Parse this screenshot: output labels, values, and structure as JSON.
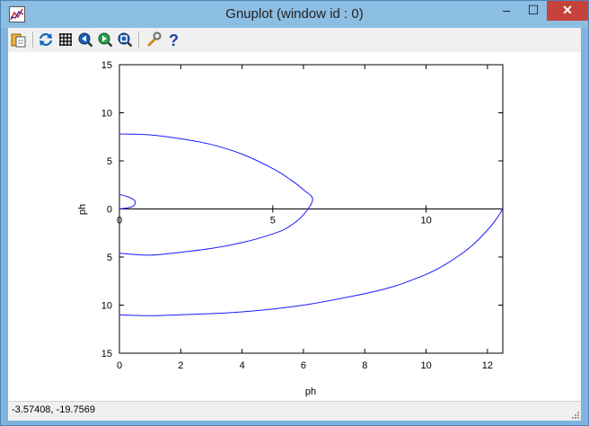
{
  "window": {
    "title": "Gnuplot (window id : 0)",
    "controls": {
      "minimize": "–",
      "maximize": "☐",
      "close": "✕"
    }
  },
  "toolbar": {
    "buttons": [
      "copy-to-clipboard-icon",
      "replot-icon",
      "grid-icon",
      "zoom-previous-icon",
      "zoom-next-icon",
      "unzoom-icon",
      "options-icon",
      "help-icon"
    ]
  },
  "statusbar": {
    "coordinates": "-3.57408, -19.7569"
  },
  "chart_data": {
    "type": "line",
    "xlabel": "ph",
    "ylabel": "ph",
    "x_ticks_bottom": [
      "0",
      "2",
      "4",
      "6",
      "8",
      "10",
      "12"
    ],
    "x_ticks_axis": [
      "0",
      "5",
      "10"
    ],
    "y_ticks": [
      "15",
      "10",
      "5",
      "0",
      "5",
      "10",
      "15"
    ],
    "xlim": [
      0,
      12.5
    ],
    "ylim": [
      -15,
      15
    ],
    "series": [
      {
        "color": "#1a1aff",
        "x": [
          0,
          0.25,
          0.45,
          0.52,
          0.45,
          0.25,
          0
        ],
        "y": [
          1.5,
          1.3,
          1.0,
          0.7,
          0.3,
          0.1,
          0
        ]
      },
      {
        "color": "#1a1aff",
        "x": [
          0,
          1.0,
          2.0,
          3.0,
          4.0,
          5.0,
          5.6,
          6.0,
          6.3,
          6.0,
          5.5,
          5.0,
          4.0,
          3.0,
          2.0,
          1.0,
          0
        ],
        "y": [
          7.8,
          7.7,
          7.3,
          6.7,
          5.7,
          4.2,
          3.0,
          2.0,
          1.0,
          -0.6,
          -1.9,
          -2.6,
          -3.5,
          -4.1,
          -4.5,
          -4.8,
          -4.6
        ]
      },
      {
        "color": "#1a1aff",
        "x": [
          0,
          1.0,
          2.0,
          4.0,
          6.0,
          8.0,
          9.0,
          10.0,
          10.5,
          11.0,
          11.5,
          12.0,
          12.3,
          12.5
        ],
        "y": [
          -11.0,
          -11.1,
          -11.0,
          -10.7,
          -10.0,
          -8.8,
          -8.0,
          -6.8,
          -6.0,
          -5.0,
          -3.8,
          -2.2,
          -1.0,
          0
        ]
      }
    ]
  }
}
